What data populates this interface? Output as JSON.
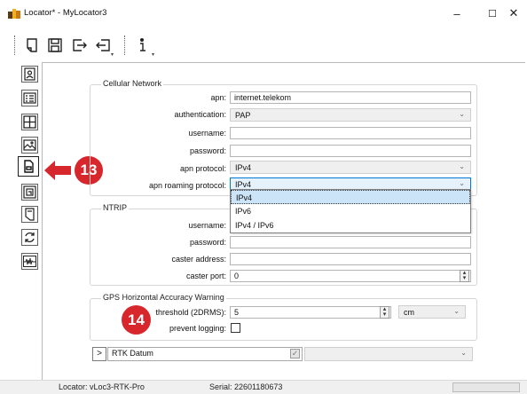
{
  "window": {
    "title": "Locator* - MyLocator3",
    "minimize": "–",
    "maximize": "☐",
    "close": "✕"
  },
  "toolbar": {
    "items": [
      "new-icon",
      "save-icon",
      "export-icon",
      "import-icon",
      "info-icon"
    ],
    "dropdown_glyph": "▾"
  },
  "sidebar": {
    "items": [
      "user-icon",
      "list-icon",
      "grid-icon",
      "image-icon",
      "cellular-icon",
      "board-icon",
      "memory-icon",
      "sync-icon",
      "waveform-icon"
    ],
    "active_index": 4
  },
  "cellular": {
    "group_label": "Cellular Network",
    "apn_label": "apn:",
    "apn_value": "internet.telekom",
    "auth_label": "authentication:",
    "auth_value": "PAP",
    "username_label": "username:",
    "username_value": "",
    "password_label": "password:",
    "password_value": "",
    "apn_protocol_label": "apn protocol:",
    "apn_protocol_value": "IPv4",
    "roaming_label": "apn roaming protocol:",
    "roaming_value": "IPv4",
    "roaming_options": [
      "IPv4",
      "IPv6",
      "IPv4 / IPv6"
    ],
    "roaming_selected": "IPv4"
  },
  "ntrip": {
    "group_label": "NTRIP",
    "username_label": "username:",
    "password_label": "password:",
    "caster_address_label": "caster address:",
    "caster_port_label": "caster port:",
    "caster_port_value": "0"
  },
  "gps": {
    "group_label": "GPS Horizontal Accuracy Warning",
    "threshold_label": "threshold (2DRMS):",
    "threshold_value": "5",
    "unit_value": "cm",
    "prevent_logging_label": "prevent logging:",
    "prevent_logging_checked": false
  },
  "rtk": {
    "expand_glyph": ">",
    "label": "RTK Datum",
    "checked": true,
    "combo_value": ""
  },
  "status": {
    "locator": "Locator: vLoc3-RTK-Pro",
    "serial": "Serial: 22601180673"
  },
  "annotations": {
    "badge_13": "13",
    "badge_14": "14",
    "accent_color": "#d8262d"
  },
  "colors": {
    "selection": "#cce4f7",
    "combo_bg": "#efefef"
  }
}
